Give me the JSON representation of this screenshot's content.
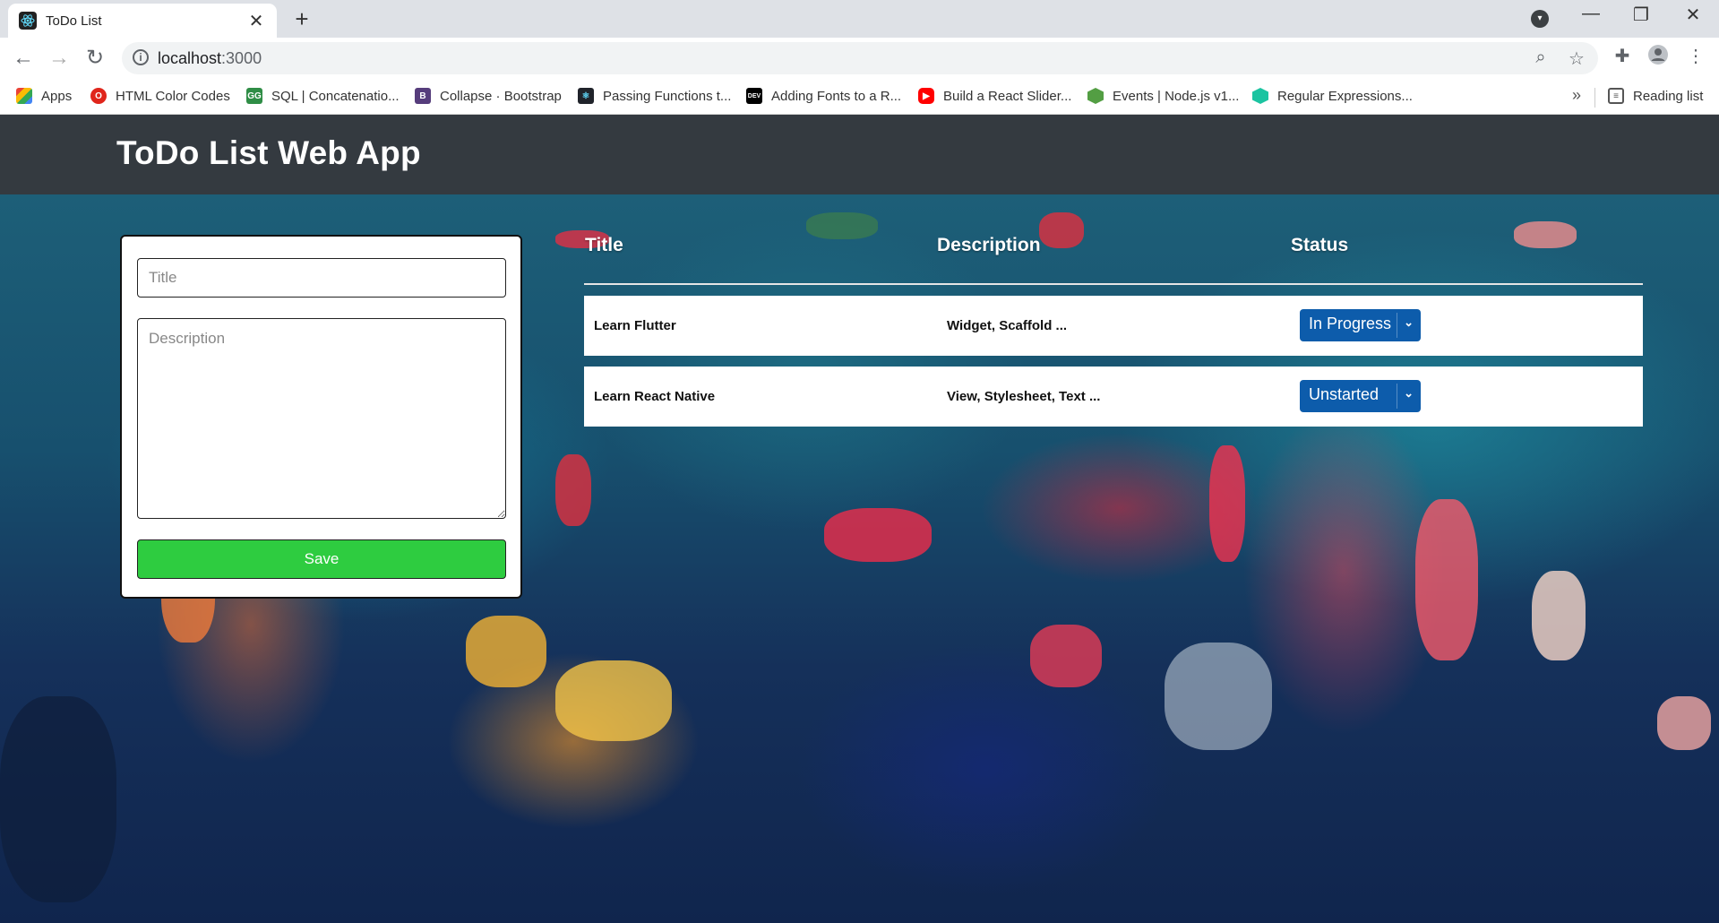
{
  "browser": {
    "tab_title": "ToDo List",
    "url_host": "localhost",
    "url_port": ":3000",
    "bookmarks": [
      {
        "label": "Apps",
        "icon": "apps-grid-icon"
      },
      {
        "label": "HTML Color Codes",
        "icon": "opera-icon"
      },
      {
        "label": "SQL | Concatenatio...",
        "icon": "geeks-icon"
      },
      {
        "label": "Collapse · Bootstrap",
        "icon": "bootstrap-icon"
      },
      {
        "label": "Passing Functions t...",
        "icon": "react-icon"
      },
      {
        "label": "Adding Fonts to a R...",
        "icon": "dev-icon"
      },
      {
        "label": "Build a React Slider...",
        "icon": "youtube-icon"
      },
      {
        "label": "Events | Node.js v1...",
        "icon": "nodejs-icon"
      },
      {
        "label": "Regular Expressions...",
        "icon": "regex-icon"
      }
    ],
    "reading_list": "Reading list"
  },
  "app": {
    "header_title": "ToDo List Web App"
  },
  "form": {
    "title_placeholder": "Title",
    "description_placeholder": "Description",
    "save_label": "Save"
  },
  "table": {
    "headers": [
      "Title",
      "Description",
      "Status"
    ],
    "rows": [
      {
        "title": "Learn Flutter",
        "description": "Widget, Scaffold ...",
        "status": "In Progress"
      },
      {
        "title": "Learn React Native",
        "description": "View, Stylesheet, Text ...",
        "status": "Unstarted"
      }
    ]
  },
  "colors": {
    "header_bg": "#343a40",
    "save_button": "#2ecc40",
    "status_select": "#0d5cab"
  }
}
